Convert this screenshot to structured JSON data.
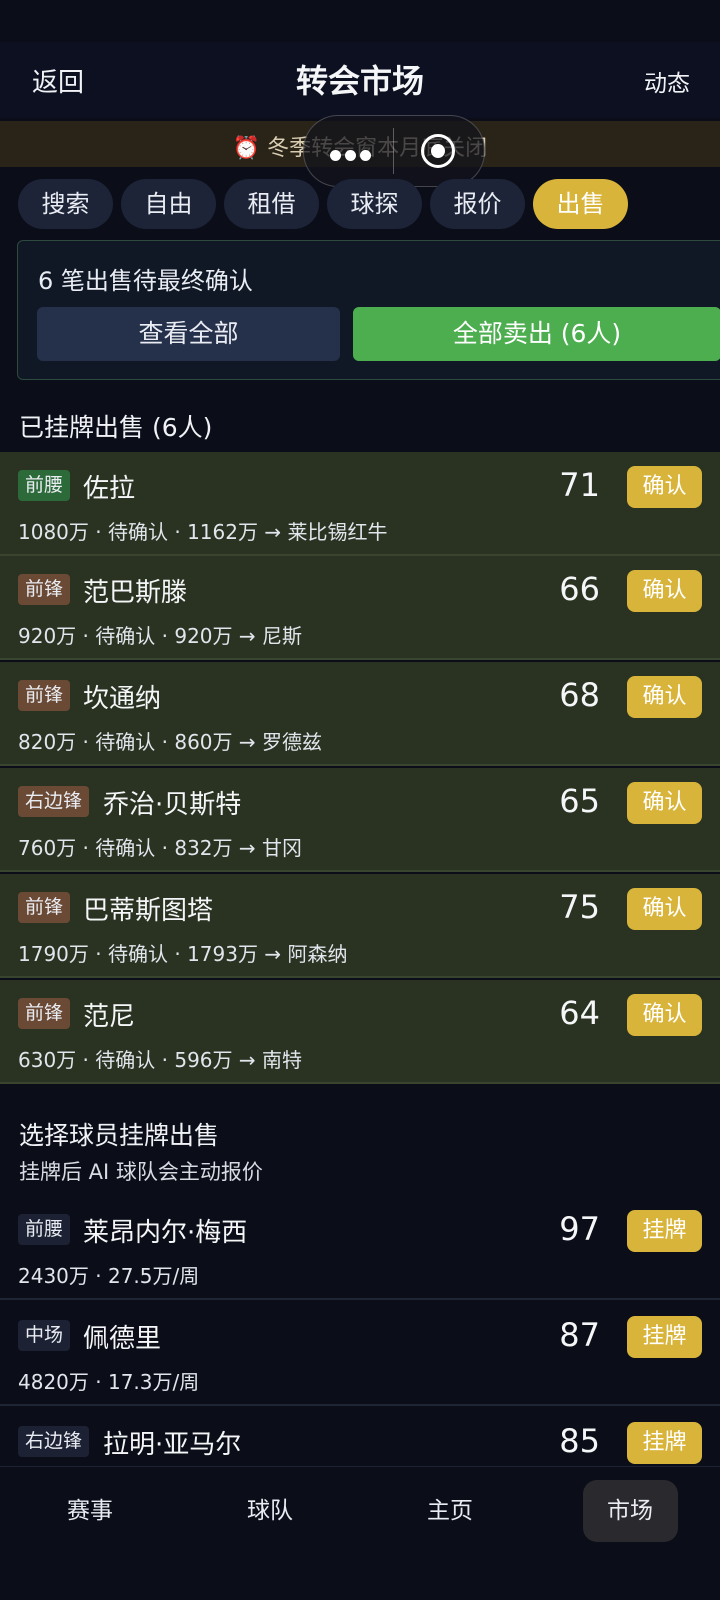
{
  "header": {
    "back_label": "返回",
    "title": "转会市场",
    "news_label": "动态"
  },
  "notice": {
    "text": "⏰ 冬季转会窗本月底关闭"
  },
  "tabs": [
    {
      "label": "搜索"
    },
    {
      "label": "自由"
    },
    {
      "label": "租借"
    },
    {
      "label": "球探"
    },
    {
      "label": "报价"
    },
    {
      "label": "出售",
      "active": true
    }
  ],
  "pending": {
    "text": "6 笔出售待最终确认",
    "view_all_label": "查看全部",
    "sell_all_label": "全部卖出 (6人)"
  },
  "listed_section": {
    "title": "已挂牌出售 (6人)"
  },
  "listed_players": [
    {
      "position": "前腰",
      "name": "佐拉",
      "rating": "71",
      "action": "确认",
      "fee": "1080万",
      "status": "待确认",
      "offer": "1162万",
      "club": "莱比锡红牛"
    },
    {
      "position": "前锋",
      "name": "范巴斯滕",
      "rating": "66",
      "action": "确认",
      "fee": "920万",
      "status": "待确认",
      "offer": "920万",
      "club": "尼斯"
    },
    {
      "position": "前锋",
      "name": "坎通纳",
      "rating": "68",
      "action": "确认",
      "fee": "820万",
      "status": "待确认",
      "offer": "860万",
      "club": "罗德兹"
    },
    {
      "position": "右边锋",
      "name": "乔治·贝斯特",
      "rating": "65",
      "action": "确认",
      "fee": "760万",
      "status": "待确认",
      "offer": "832万",
      "club": "甘冈"
    },
    {
      "position": "前锋",
      "name": "巴蒂斯图塔",
      "rating": "75",
      "action": "确认",
      "fee": "1790万",
      "status": "待确认",
      "offer": "1793万",
      "club": "阿森纳"
    },
    {
      "position": "前锋",
      "name": "范尼",
      "rating": "64",
      "action": "确认",
      "fee": "630万",
      "status": "待确认",
      "offer": "596万",
      "club": "南特"
    }
  ],
  "available_section": {
    "title": "选择球员挂牌出售",
    "subtitle": "挂牌后 AI 球队会主动报价"
  },
  "available_players": [
    {
      "position": "前腰",
      "name": "莱昂内尔·梅西",
      "rating": "97",
      "action": "挂牌",
      "value": "2430万",
      "wage": "27.5万/周"
    },
    {
      "position": "中场",
      "name": "佩德里",
      "rating": "87",
      "action": "挂牌",
      "value": "4820万",
      "wage": "17.3万/周"
    },
    {
      "position": "右边锋",
      "name": "拉明·亚马尔",
      "rating": "85",
      "action": "挂牌",
      "value": "",
      "wage": ""
    }
  ],
  "bottom_nav": [
    {
      "label": "赛事"
    },
    {
      "label": "球队"
    },
    {
      "label": "主页"
    },
    {
      "label": "市场",
      "active": true
    }
  ],
  "colors": {
    "accent_gold": "#d9b43a",
    "sell_green": "#4cae4f",
    "listed_row_bg": "#2a3322",
    "page_bg": "#0b0e18"
  }
}
